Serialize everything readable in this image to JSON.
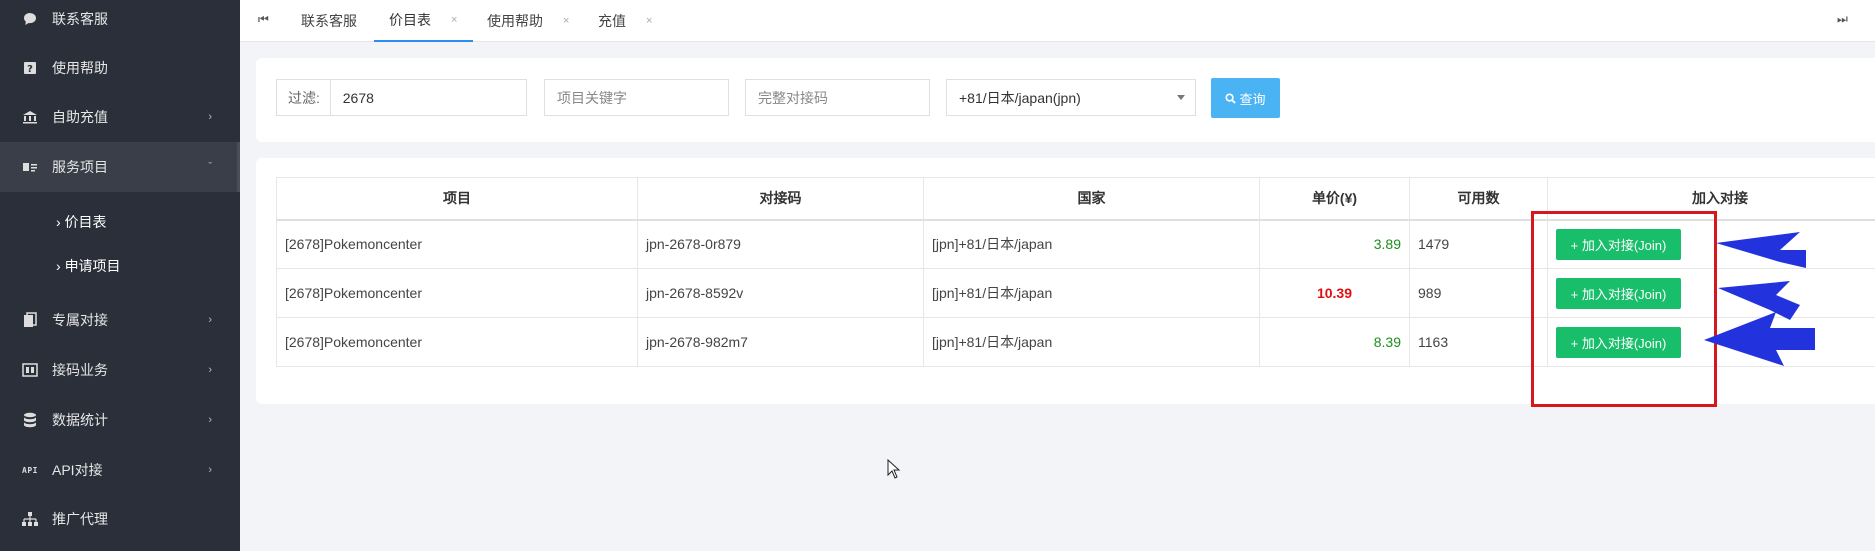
{
  "sidebar": {
    "items": [
      {
        "label": "联系客服",
        "icon": "chat-icon",
        "has_arrow": false
      },
      {
        "label": "使用帮助",
        "icon": "help-icon",
        "has_arrow": false
      },
      {
        "label": "自助充值",
        "icon": "bank-icon",
        "has_arrow": true
      },
      {
        "label": "服务项目",
        "icon": "id-card-icon",
        "has_arrow": true,
        "expanded": true
      },
      {
        "label": "专属对接",
        "icon": "copy-icon",
        "has_arrow": true
      },
      {
        "label": "接码业务",
        "icon": "grid-icon",
        "has_arrow": true
      },
      {
        "label": "数据统计",
        "icon": "database-icon",
        "has_arrow": true
      },
      {
        "label": "API对接",
        "icon": "api-icon",
        "has_arrow": true
      },
      {
        "label": "推广代理",
        "icon": "sitemap-icon",
        "has_arrow": false
      }
    ],
    "sub_items": [
      {
        "label": "价目表"
      },
      {
        "label": "申请项目"
      }
    ]
  },
  "tabs": {
    "items": [
      {
        "label": "联系客服",
        "closable": false,
        "active": false
      },
      {
        "label": "价目表",
        "closable": true,
        "active": true
      },
      {
        "label": "使用帮助",
        "closable": true,
        "active": false
      },
      {
        "label": "充值",
        "closable": true,
        "active": false
      }
    ],
    "close_glyph": "×"
  },
  "filter": {
    "prefix_label": "过滤:",
    "filter_value": "2678",
    "keyword_placeholder": "项目关键字",
    "code_placeholder": "完整对接码",
    "country_selected": "+81/日本/japan(jpn)",
    "query_label": "查询"
  },
  "table": {
    "columns": [
      "项目",
      "对接码",
      "国家",
      "单价(¥)",
      "可用数",
      "加入对接"
    ],
    "rows": [
      {
        "project": "[2678]Pokemoncenter",
        "code": "jpn-2678-0r879",
        "country": "[jpn]+81/日本/japan",
        "price": "3.89",
        "price_style": "green",
        "available": "1479",
        "action": "+ 加入对接(Join)"
      },
      {
        "project": "[2678]Pokemoncenter",
        "code": "jpn-2678-8592v",
        "country": "[jpn]+81/日本/japan",
        "price": "10.39",
        "price_style": "red",
        "available": "989",
        "action": "+ 加入对接(Join)"
      },
      {
        "project": "[2678]Pokemoncenter",
        "code": "jpn-2678-982m7",
        "country": "[jpn]+81/日本/japan",
        "price": "8.39",
        "price_style": "green",
        "available": "1163",
        "action": "+ 加入对接(Join)"
      }
    ]
  },
  "colors": {
    "sidebar_bg": "#2b2f3a",
    "join_button": "#19be6b",
    "query_button": "#4ab3f4",
    "annotation_red": "#d6181c",
    "annotation_blue": "#2233dd"
  }
}
